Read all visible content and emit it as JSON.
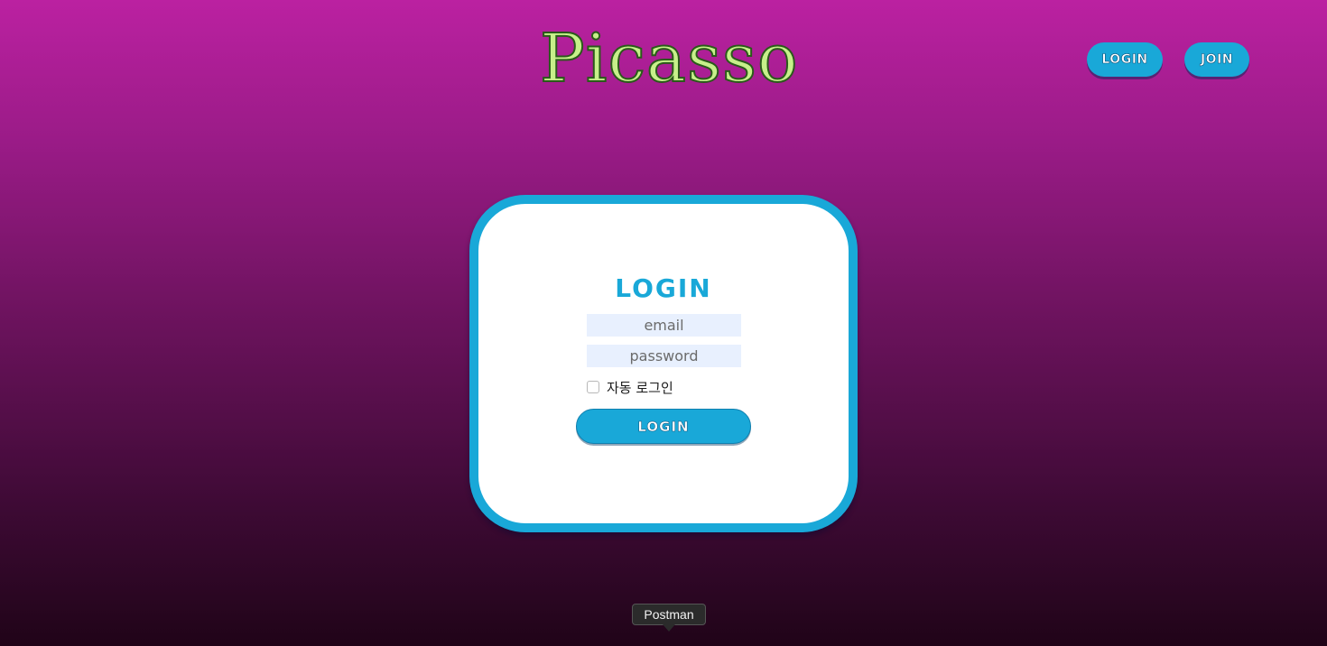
{
  "header": {
    "brand": "Picasso",
    "nav_login_label": "LOGIN",
    "nav_join_label": "JOIN"
  },
  "login_form": {
    "title": "LOGIN",
    "email_placeholder": "email",
    "password_placeholder": "password",
    "remember_label": "자동 로그인",
    "remember_checked": false,
    "submit_label": "LOGIN"
  },
  "dock_tooltip": {
    "label": "Postman"
  },
  "colors": {
    "accent": "#19a8d8",
    "brand_text": "#c7f08a",
    "background_top": "#bb21a1",
    "background_bottom": "#200418"
  }
}
